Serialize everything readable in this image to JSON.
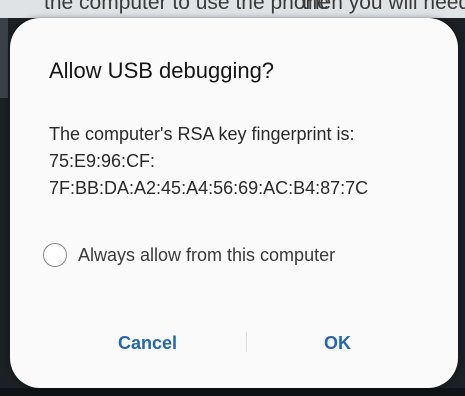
{
  "background": {
    "top_text_left": "the computer to use the phone",
    "top_text_right": "then you will need to set"
  },
  "dialog": {
    "title": "Allow USB debugging?",
    "body_line1": "The computer's RSA key fingerprint is:",
    "body_line2": "75:E9:96:CF:",
    "body_line3": "7F:BB:DA:A2:45:A4:56:69:AC:B4:87:7C",
    "checkbox_label": "Always allow from this computer",
    "checkbox_checked": false,
    "cancel_label": "Cancel",
    "ok_label": "OK"
  },
  "colors": {
    "accent": "#2167b5",
    "dialog_background": "#fafafa",
    "title_text": "#161616",
    "body_text": "#2a2a2a"
  }
}
